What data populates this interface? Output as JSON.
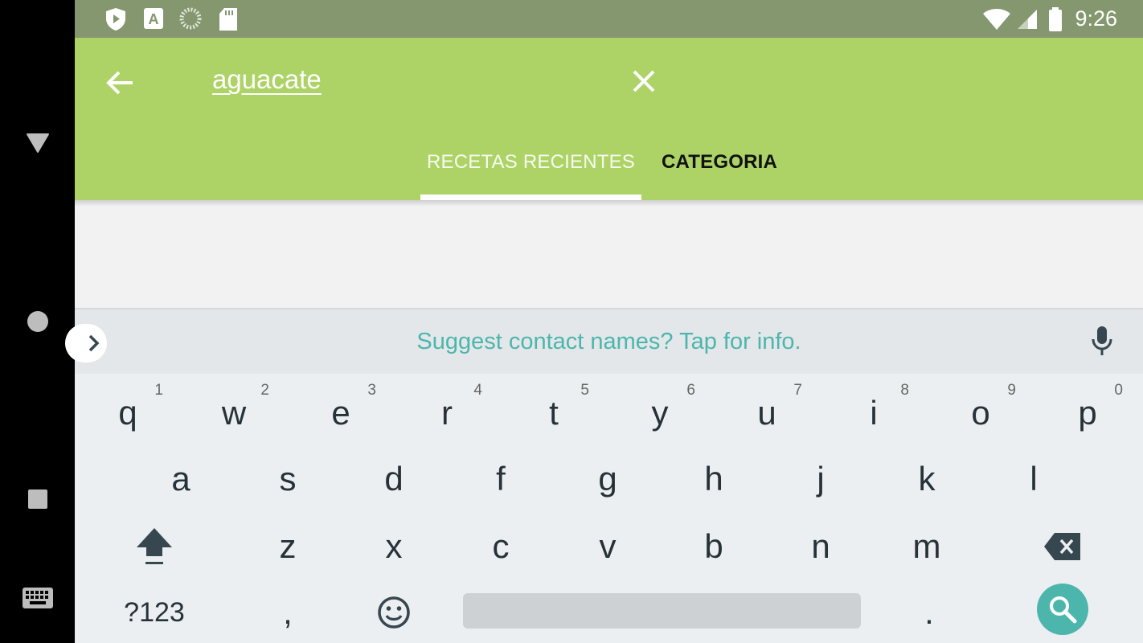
{
  "navigation_bar": {
    "back": "back-triangle-icon",
    "home": "home-circle-icon",
    "recents": "recents-square-icon",
    "keyboard_switch": "keyboard-icon"
  },
  "status_bar": {
    "left_icons": [
      "play-protect-icon",
      "text-a-icon",
      "loading-circle-icon",
      "sd-card-icon"
    ],
    "right_icons": [
      "wifi-icon",
      "signal-icon",
      "battery-icon"
    ],
    "time": "9:26"
  },
  "app_bar": {
    "search_query": "aguacate",
    "tabs": [
      {
        "label": "RECETAS RECIENTES",
        "selected": true
      },
      {
        "label": "CATEGORIA",
        "selected": false
      }
    ],
    "colors": {
      "background": "#add366",
      "status_bar": "#84976f"
    }
  },
  "keyboard": {
    "suggestion": "Suggest contact names? Tap for info.",
    "row1": [
      {
        "key": "q",
        "hint": "1"
      },
      {
        "key": "w",
        "hint": "2"
      },
      {
        "key": "e",
        "hint": "3"
      },
      {
        "key": "r",
        "hint": "4"
      },
      {
        "key": "t",
        "hint": "5"
      },
      {
        "key": "y",
        "hint": "6"
      },
      {
        "key": "u",
        "hint": "7"
      },
      {
        "key": "i",
        "hint": "8"
      },
      {
        "key": "o",
        "hint": "9"
      },
      {
        "key": "p",
        "hint": "0"
      }
    ],
    "row2": [
      "a",
      "s",
      "d",
      "f",
      "g",
      "h",
      "j",
      "k",
      "l"
    ],
    "row3": [
      "z",
      "x",
      "c",
      "v",
      "b",
      "n",
      "m"
    ],
    "symbols_label": "?123",
    "comma": ",",
    "period": ".",
    "accent_color": "#4db6ac"
  }
}
